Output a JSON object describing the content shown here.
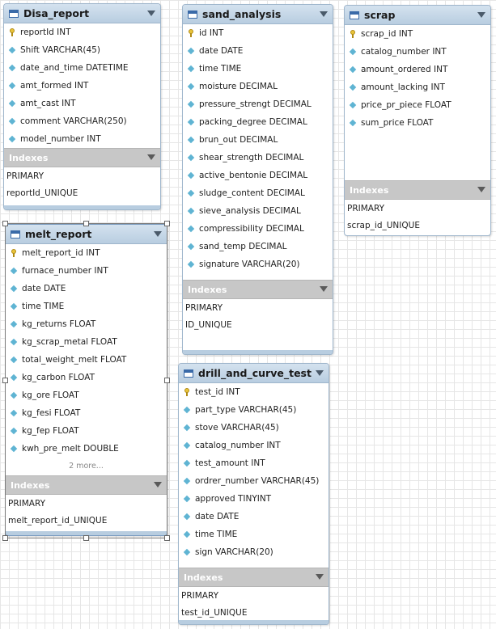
{
  "tables": {
    "disa_report": {
      "name": "Disa_report",
      "columns": [
        {
          "text": "reportId INT",
          "kind": "key"
        },
        {
          "text": "Shift VARCHAR(45)",
          "kind": "col"
        },
        {
          "text": "date_and_time DATETIME",
          "kind": "col"
        },
        {
          "text": "amt_formed INT",
          "kind": "col"
        },
        {
          "text": "amt_cast INT",
          "kind": "col"
        },
        {
          "text": "comment VARCHAR(250)",
          "kind": "col"
        },
        {
          "text": "model_number INT",
          "kind": "col"
        }
      ],
      "indexes_label": "Indexes",
      "indexes": [
        "PRIMARY",
        "reportId_UNIQUE"
      ]
    },
    "sand_analysis": {
      "name": "sand_analysis",
      "columns": [
        {
          "text": "id INT",
          "kind": "key"
        },
        {
          "text": "date DATE",
          "kind": "col"
        },
        {
          "text": "time TIME",
          "kind": "col"
        },
        {
          "text": "moisture DECIMAL",
          "kind": "col"
        },
        {
          "text": "pressure_strengt DECIMAL",
          "kind": "col"
        },
        {
          "text": "packing_degree DECIMAL",
          "kind": "col"
        },
        {
          "text": "brun_out DECIMAL",
          "kind": "col"
        },
        {
          "text": "shear_strength DECIMAL",
          "kind": "col"
        },
        {
          "text": "active_bentonie DECIMAL",
          "kind": "col"
        },
        {
          "text": "sludge_content DECIMAL",
          "kind": "col"
        },
        {
          "text": "sieve_analysis DECIMAL",
          "kind": "col"
        },
        {
          "text": "compressibility DECIMAL",
          "kind": "col"
        },
        {
          "text": "sand_temp DECIMAL",
          "kind": "col"
        },
        {
          "text": "signature VARCHAR(20)",
          "kind": "col"
        }
      ],
      "indexes_label": "Indexes",
      "indexes": [
        "PRIMARY",
        "ID_UNIQUE"
      ]
    },
    "scrap": {
      "name": "scrap",
      "columns": [
        {
          "text": "scrap_id INT",
          "kind": "key"
        },
        {
          "text": "catalog_number INT",
          "kind": "col"
        },
        {
          "text": "amount_ordered INT",
          "kind": "col"
        },
        {
          "text": "amount_lacking INT",
          "kind": "col"
        },
        {
          "text": "price_pr_piece FLOAT",
          "kind": "col"
        },
        {
          "text": "sum_price FLOAT",
          "kind": "col"
        }
      ],
      "indexes_label": "Indexes",
      "indexes": [
        "PRIMARY",
        "scrap_id_UNIQUE"
      ]
    },
    "melt_report": {
      "name": "melt_report",
      "columns": [
        {
          "text": "melt_report_id INT",
          "kind": "key"
        },
        {
          "text": "furnace_number INT",
          "kind": "col"
        },
        {
          "text": "date DATE",
          "kind": "col"
        },
        {
          "text": "time TIME",
          "kind": "col"
        },
        {
          "text": "kg_returns FLOAT",
          "kind": "col"
        },
        {
          "text": "kg_scrap_metal FLOAT",
          "kind": "col"
        },
        {
          "text": "total_weight_melt FLOAT",
          "kind": "col"
        },
        {
          "text": "kg_carbon FLOAT",
          "kind": "col"
        },
        {
          "text": "kg_ore FLOAT",
          "kind": "col"
        },
        {
          "text": "kg_fesi FLOAT",
          "kind": "col"
        },
        {
          "text": "kg_fep FLOAT",
          "kind": "col"
        },
        {
          "text": "kwh_pre_melt DOUBLE",
          "kind": "col"
        }
      ],
      "more": "2 more...",
      "indexes_label": "Indexes",
      "indexes": [
        "PRIMARY",
        "melt_report_id_UNIQUE"
      ]
    },
    "drill_and_curve_test": {
      "name": "drill_and_curve_test",
      "columns": [
        {
          "text": "test_id INT",
          "kind": "key"
        },
        {
          "text": "part_type VARCHAR(45)",
          "kind": "col"
        },
        {
          "text": "stove VARCHAR(45)",
          "kind": "col"
        },
        {
          "text": "catalog_number INT",
          "kind": "col"
        },
        {
          "text": "test_amount INT",
          "kind": "col"
        },
        {
          "text": "ordrer_number VARCHAR(45)",
          "kind": "col"
        },
        {
          "text": "approved TINYINT",
          "kind": "col"
        },
        {
          "text": "date DATE",
          "kind": "col"
        },
        {
          "text": "time TIME",
          "kind": "col"
        },
        {
          "text": "sign VARCHAR(20)",
          "kind": "col"
        }
      ],
      "indexes_label": "Indexes",
      "indexes": [
        "PRIMARY",
        "test_id_UNIQUE"
      ]
    }
  }
}
